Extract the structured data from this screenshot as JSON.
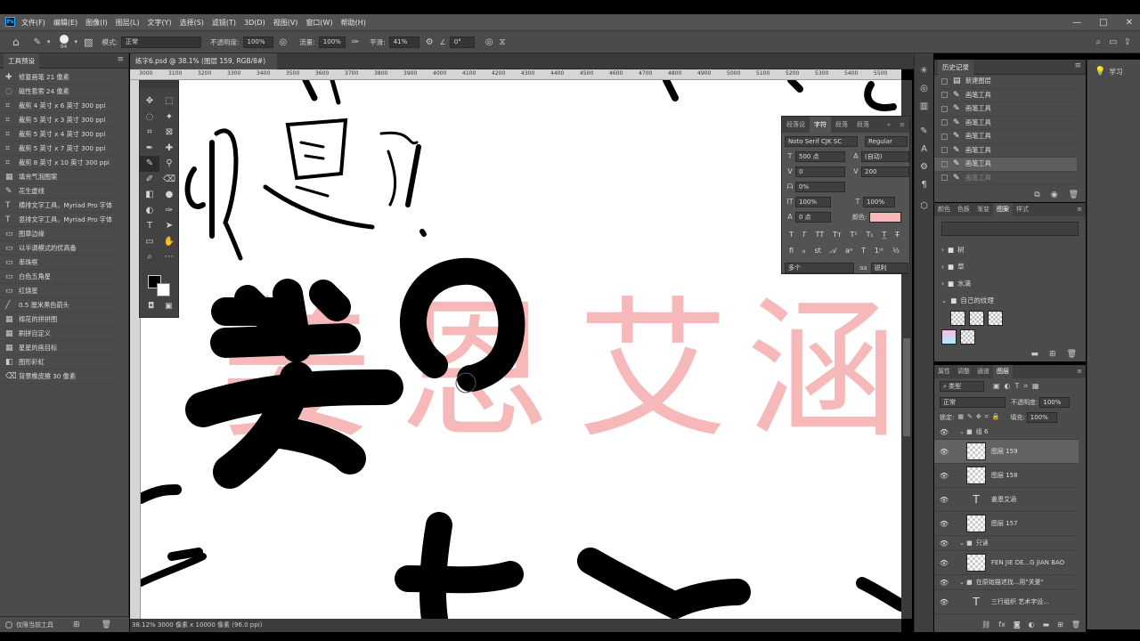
{
  "menubar": {
    "app_icon": "Ps",
    "items": [
      "文件(F)",
      "编辑(E)",
      "图像(I)",
      "图层(L)",
      "文字(Y)",
      "选择(S)",
      "滤镜(T)",
      "3D(D)",
      "视图(V)",
      "窗口(W)",
      "帮助(H)"
    ],
    "window_controls": [
      "—",
      "□",
      "✕"
    ]
  },
  "options": {
    "brush_size": "94",
    "mode_label": "模式:",
    "mode_value": "正常",
    "opacity_label": "不透明度:",
    "opacity_value": "100%",
    "flow_label": "流量:",
    "flow_value": "100%",
    "smooth_label": "平滑:",
    "smooth_value": "41%",
    "angle_value": "0°"
  },
  "tool_presets": {
    "title": "工具预设",
    "items": [
      {
        "icon": "spot-heal-icon",
        "label": "修复画笔 21 像素"
      },
      {
        "icon": "lasso-icon",
        "label": "磁性套索 24 像素"
      },
      {
        "icon": "crop-icon",
        "label": "裁剪 4 英寸 x 6 英寸 300 ppi"
      },
      {
        "icon": "crop-icon",
        "label": "裁剪 5 英寸 x 3 英寸 300 ppi"
      },
      {
        "icon": "crop-icon",
        "label": "裁剪 5 英寸 x 4 英寸 300 ppi"
      },
      {
        "icon": "crop-icon",
        "label": "裁剪 5 英寸 x 7 英寸 300 ppi"
      },
      {
        "icon": "crop-icon",
        "label": "裁剪 8 英寸 x 10 英寸 300 ppi"
      },
      {
        "icon": "pattern-icon",
        "label": "填充气泡图案"
      },
      {
        "icon": "brush-icon",
        "label": "花生虚线"
      },
      {
        "icon": "type-icon",
        "label": "横排文字工具，Myriad Pro 字体"
      },
      {
        "icon": "type-icon",
        "label": "竖排文字工具，Myriad Pro 字体"
      },
      {
        "icon": "shape-icon",
        "label": "图章边缘"
      },
      {
        "icon": "shape-icon",
        "label": "以半调模式的优高备"
      },
      {
        "icon": "shape-icon",
        "label": "串珠框"
      },
      {
        "icon": "shape-icon",
        "label": "白色五角星"
      },
      {
        "icon": "shape-icon",
        "label": "红烧星"
      },
      {
        "icon": "line-icon",
        "label": "0.5 厘米黑色箭头"
      },
      {
        "icon": "pattern-icon",
        "label": "棉花的拼拼图"
      },
      {
        "icon": "pattern-icon",
        "label": "刷拼自定义"
      },
      {
        "icon": "pattern-icon",
        "label": "星星的画目标"
      },
      {
        "icon": "gradient-icon",
        "label": "图形彩虹"
      },
      {
        "icon": "eraser-icon",
        "label": "背景橡皮擦 30 像素"
      }
    ],
    "footer_checkbox": "仅限当前工具"
  },
  "document": {
    "tab": "练字6.psd @ 38.1% (图层 159, RGB/8#) *",
    "status": "38.12%   3000 像素 x 10000 像素 (96.0 ppi)",
    "ruler_ticks": [
      "3000",
      "3100",
      "3200",
      "3300",
      "3400",
      "3500",
      "3600",
      "3700",
      "3800",
      "3900",
      "4000",
      "4100",
      "4200",
      "4300",
      "4400",
      "4500",
      "4600",
      "4700",
      "4800",
      "4900",
      "5000",
      "5100",
      "5200",
      "5300",
      "5400",
      "5500",
      "5600"
    ],
    "ghost_text": [
      "姜",
      "恩",
      "艾",
      "涵"
    ]
  },
  "character": {
    "tabs": [
      "段落设",
      "字符",
      "段落",
      "段落"
    ],
    "font_family": "Noto Serif CJK SC",
    "font_style": "Regular",
    "size": "500 点",
    "leading": "(自动)",
    "kerning": "0",
    "tracking": "200",
    "tsume": "0%",
    "vscale": "100%",
    "hscale": "100%",
    "baseline": "0 点",
    "color_label": "颜色:",
    "color": "#f6b8b8",
    "lang": "多个",
    "aa_label": "aa",
    "aa_value": "锐利"
  },
  "history": {
    "title": "历史记录",
    "items": [
      {
        "label": "新建图层",
        "icon": "layer-icon"
      },
      {
        "label": "画笔工具",
        "icon": "brush-icon"
      },
      {
        "label": "画笔工具",
        "icon": "brush-icon"
      },
      {
        "label": "画笔工具",
        "icon": "brush-icon"
      },
      {
        "label": "画笔工具",
        "icon": "brush-icon"
      },
      {
        "label": "画笔工具",
        "icon": "brush-icon"
      },
      {
        "label": "画笔工具",
        "icon": "brush-icon",
        "selected": true
      },
      {
        "label": "画笔工具",
        "icon": "brush-icon",
        "dim": true
      }
    ]
  },
  "learn": {
    "label": "学习"
  },
  "swatches": {
    "tabs": [
      "颜色",
      "色板",
      "渐变",
      "图案",
      "样式"
    ],
    "active": "图案",
    "folders": [
      "树",
      "草",
      "水滴",
      "自己的纹理"
    ]
  },
  "layers": {
    "tabs": [
      "属性",
      "调整",
      "通道",
      "图层"
    ],
    "filter_label": "类型",
    "blend": "正常",
    "opacity_label": "不透明度:",
    "opacity": "100%",
    "lock_label": "锁定:",
    "fill_label": "填充:",
    "fill": "100%",
    "rows": [
      {
        "type": "group",
        "name": "组 6"
      },
      {
        "type": "layer",
        "name": "图层 159",
        "selected": true
      },
      {
        "type": "layer",
        "name": "图层 158"
      },
      {
        "type": "text",
        "name": "姜恩艾涵"
      },
      {
        "type": "layer",
        "name": "图层 157"
      },
      {
        "type": "group",
        "name": "只读"
      },
      {
        "type": "layer",
        "name": "FEN JIE DE...G JIAN BAO"
      },
      {
        "type": "group",
        "name": "在原始描述找...用\"关爱\""
      },
      {
        "type": "text",
        "name": "三行组织  艺术字设..."
      }
    ]
  }
}
